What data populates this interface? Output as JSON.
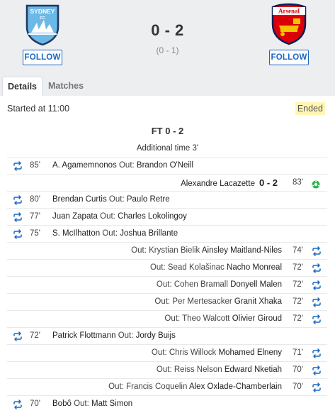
{
  "match": {
    "home": {
      "name": "Sydney FC",
      "crest_text": "SYDNEY",
      "crest_sub": "FC",
      "follow_label": "FOLLOW",
      "color": "#6cb8e6"
    },
    "away": {
      "name": "Arsenal",
      "crest_text": "Arsenal",
      "follow_label": "FOLLOW",
      "color": "#db0007"
    },
    "score": "0 - 2",
    "half_time": "(0 - 1)"
  },
  "tabs": [
    {
      "label": "Details",
      "active": true
    },
    {
      "label": "Matches",
      "active": false
    }
  ],
  "details": {
    "started": "Started at 11:00",
    "status": "Ended",
    "ft": "FT 0 - 2",
    "additional_time": "Additional time 3'"
  },
  "events": [
    {
      "side": "home",
      "type": "sub",
      "minute": "85'",
      "player_in": "A. Agamemnonos",
      "out_label": "Out:",
      "player_out": "Brandon O'Neill"
    },
    {
      "side": "away",
      "type": "goal",
      "minute": "83'",
      "player": "Alexandre Lacazette",
      "score": "0 - 2"
    },
    {
      "side": "home",
      "type": "sub",
      "minute": "80'",
      "player_in": "Brendan Curtis",
      "out_label": "Out:",
      "player_out": "Paulo Retre"
    },
    {
      "side": "home",
      "type": "sub",
      "minute": "77'",
      "player_in": "Juan Zapata",
      "out_label": "Out:",
      "player_out": "Charles Lokolingoy"
    },
    {
      "side": "home",
      "type": "sub",
      "minute": "75'",
      "player_in": "S. McIlhatton",
      "out_label": "Out:",
      "player_out": "Joshua Brillante"
    },
    {
      "side": "away",
      "type": "sub",
      "minute": "74'",
      "player_in": "Ainsley Maitland-Niles",
      "out_label": "Out:",
      "player_out": "Krystian Bielik"
    },
    {
      "side": "away",
      "type": "sub",
      "minute": "72'",
      "player_in": "Nacho Monreal",
      "out_label": "Out:",
      "player_out": "Sead Kolašinac"
    },
    {
      "side": "away",
      "type": "sub",
      "minute": "72'",
      "player_in": "Donyell Malen",
      "out_label": "Out:",
      "player_out": "Cohen Bramall"
    },
    {
      "side": "away",
      "type": "sub",
      "minute": "72'",
      "player_in": "Granit Xhaka",
      "out_label": "Out:",
      "player_out": "Per Mertesacker"
    },
    {
      "side": "away",
      "type": "sub",
      "minute": "72'",
      "player_in": "Olivier Giroud",
      "out_label": "Out:",
      "player_out": "Theo Walcott"
    },
    {
      "side": "home",
      "type": "sub",
      "minute": "72'",
      "player_in": "Patrick Flottmann",
      "out_label": "Out:",
      "player_out": "Jordy Buijs"
    },
    {
      "side": "away",
      "type": "sub",
      "minute": "71'",
      "player_in": "Mohamed Elneny",
      "out_label": "Out:",
      "player_out": "Chris Willock"
    },
    {
      "side": "away",
      "type": "sub",
      "minute": "70'",
      "player_in": "Edward Nketiah",
      "out_label": "Out:",
      "player_out": "Reiss Nelson"
    },
    {
      "side": "away",
      "type": "sub",
      "minute": "70'",
      "player_in": "Alex Oxlade-Chamberlain",
      "out_label": "Out:",
      "player_out": "Francis Coquelin"
    },
    {
      "side": "home",
      "type": "sub",
      "minute": "70'",
      "player_in": "Bobô",
      "out_label": "Out:",
      "player_out": "Matt Simon"
    }
  ],
  "colors": {
    "accent": "#1a66c2",
    "ended_bg": "#fff6b3",
    "goal_green": "#2db34a"
  }
}
